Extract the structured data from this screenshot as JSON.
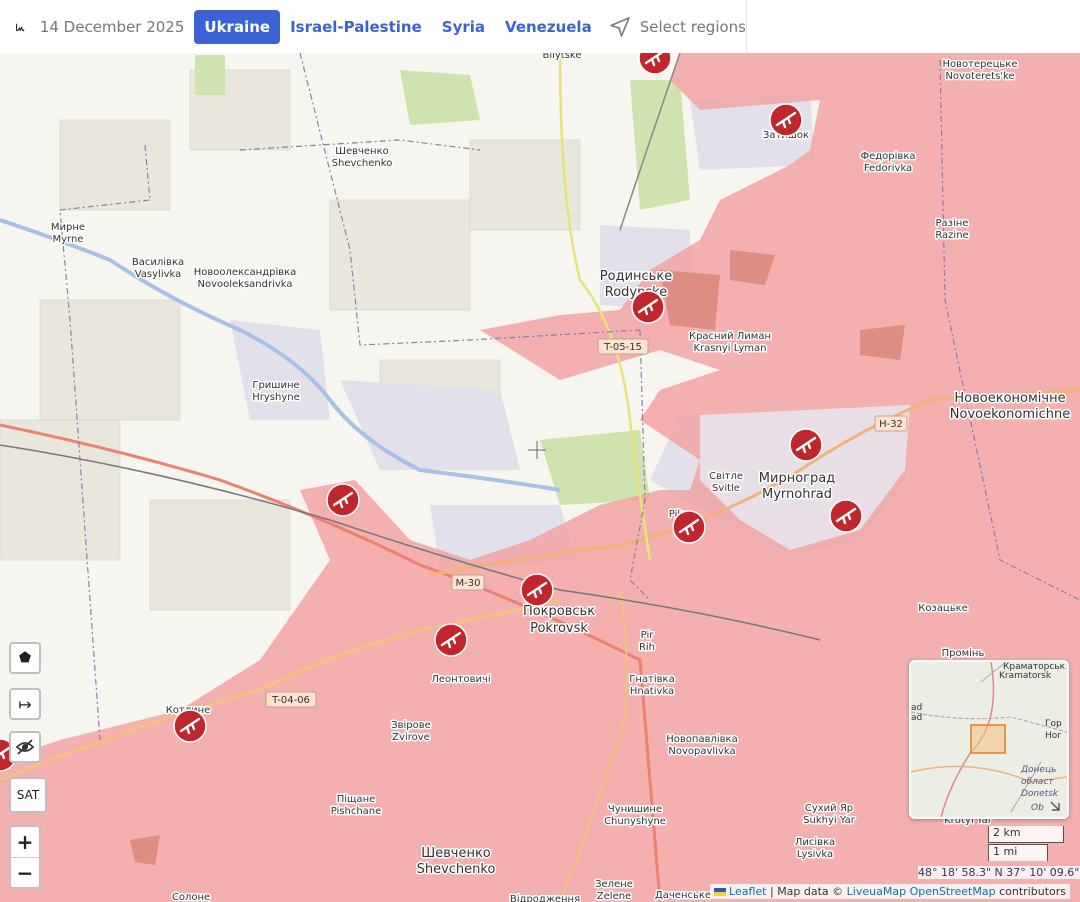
{
  "header": {
    "date": "14 December 2025",
    "tabs": [
      {
        "label": "Ukraine",
        "active": true
      },
      {
        "label": "Israel-Palestine",
        "active": false
      },
      {
        "label": "Syria",
        "active": false
      },
      {
        "label": "Venezuela",
        "active": false
      }
    ],
    "regions_label": "Select regions"
  },
  "colors": {
    "accent": "#3b63d6",
    "occupied": "#f2a3a3",
    "combat_icon": "#c0262b"
  },
  "map": {
    "labels": [
      {
        "text": "Bilytske"
      },
      {
        "text": "Новотерецьке"
      },
      {
        "text": "Novoterets'ke"
      },
      {
        "text": "Затишок"
      },
      {
        "text": "Шевченко"
      },
      {
        "text": "Shevchenko"
      },
      {
        "text": "Федорівка"
      },
      {
        "text": "Fedorivka"
      },
      {
        "text": "Мирне"
      },
      {
        "text": "Myrne"
      },
      {
        "text": "Разіне"
      },
      {
        "text": "Razine"
      },
      {
        "text": "Василівка"
      },
      {
        "text": "Vasylivka"
      },
      {
        "text": "Новоолександрівка"
      },
      {
        "text": "Novooleksandrivka"
      },
      {
        "text": "Родинське"
      },
      {
        "text": "Rodynske"
      },
      {
        "text": "Красний Лиман"
      },
      {
        "text": "Krasnyi Lyman"
      },
      {
        "text": "Гришине"
      },
      {
        "text": "Hryshyne"
      },
      {
        "text": "Новоекономічне"
      },
      {
        "text": "Novoekonomichne"
      },
      {
        "text": "Світле"
      },
      {
        "text": "Svitle"
      },
      {
        "text": "Мирноград"
      },
      {
        "text": "Myrnohrad"
      },
      {
        "text": "Pik"
      },
      {
        "text": "Покровськ"
      },
      {
        "text": "Pokrovsk"
      },
      {
        "text": "Козацьке"
      },
      {
        "text": "Pir"
      },
      {
        "text": "Rih"
      },
      {
        "text": "Промінь"
      },
      {
        "text": "Леонтовичі"
      },
      {
        "text": "Гнатівка"
      },
      {
        "text": "Hnativka"
      },
      {
        "text": "Котлине"
      },
      {
        "text": "Звірове"
      },
      {
        "text": "Zvirove"
      },
      {
        "text": "Новопавлівка"
      },
      {
        "text": "Novopavlivka"
      },
      {
        "text": "Сухий Яр"
      },
      {
        "text": "Sukhyi Yar"
      },
      {
        "text": "Піщане"
      },
      {
        "text": "Pishchane"
      },
      {
        "text": "Чунишине"
      },
      {
        "text": "Chunyshyne"
      },
      {
        "text": "Лисівка"
      },
      {
        "text": "Lysivka"
      },
      {
        "text": "Krutyi Yar"
      },
      {
        "text": "Шевченко"
      },
      {
        "text": "Shevchenko"
      },
      {
        "text": "Зелене"
      },
      {
        "text": "Zelene"
      },
      {
        "text": "Даченське"
      },
      {
        "text": "Солоне"
      },
      {
        "text": "Відродження"
      }
    ],
    "roads": [
      "T-05-15",
      "H-32",
      "M-30",
      "T-04-06"
    ]
  },
  "controls": {
    "draw_polygon": "⬟",
    "measure": "↦",
    "hide": "hide",
    "satellite": "SAT",
    "zoom_in": "+",
    "zoom_out": "−"
  },
  "minimap": {
    "labels": [
      "Краматорськ",
      "Kramatorsk",
      "Гор",
      "Hor",
      "Донець",
      "област",
      "Donetsk",
      "Ob",
      "ad",
      "ad"
    ]
  },
  "scale": {
    "km": "2 km",
    "mi": "1 mi"
  },
  "coords": "48° 18' 58.3\" N 37° 10' 09.6\" E",
  "attribution": {
    "leaflet": "Leaflet",
    "sep1": "|",
    "map_data": "Map data ©",
    "liveuamap": "LiveuaMap",
    "osm": "OpenStreetMap",
    "contributors": "contributors"
  }
}
